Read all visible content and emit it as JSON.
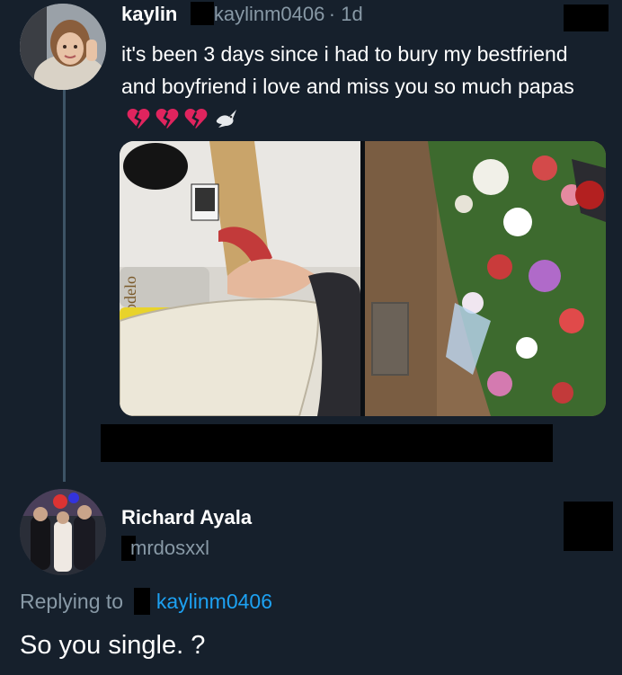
{
  "tweet": {
    "display_name": "kaylin",
    "handle": "kaylinm0406",
    "time": "· 1d",
    "text": "it's been 3 days since i had to bury my bestfriend and boyfriend i love and miss you so much papas",
    "emoji": [
      "broken-heart-icon",
      "broken-heart-icon",
      "broken-heart-icon",
      "dove-icon"
    ],
    "image_left_label": "odelo"
  },
  "reply": {
    "display_name": "Richard Ayala",
    "handle": "mrdosxxl",
    "replying_prefix": "Replying to",
    "replying_handle": "kaylinm0406",
    "text": "So you single. ?"
  },
  "colors": {
    "background": "#16202c",
    "link": "#1da1f2",
    "muted": "#8899a6",
    "heart": "#e0245e"
  }
}
